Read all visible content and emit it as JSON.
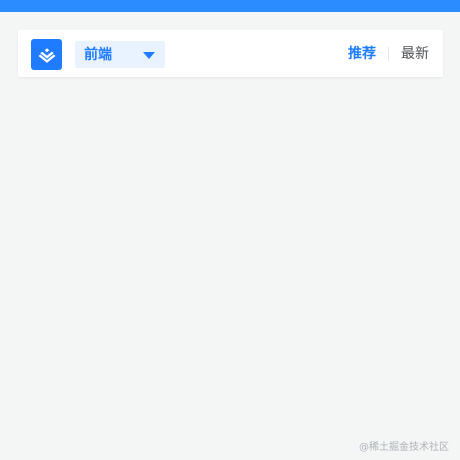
{
  "app": {
    "category_dropdown": {
      "selected": "前端"
    },
    "tabs": [
      {
        "label": "推荐"
      },
      {
        "label": "最新"
      }
    ],
    "watermark": "@稀土掘金技术社区"
  },
  "colors": {
    "brand_blue": "#1f7cff",
    "top_bar": "#2b8cff",
    "active_tab": "#1f7cff",
    "inactive_tab": "#4d4f53",
    "page_bg": "#f4f5f5",
    "card_bg": "#ffffff",
    "dropdown_bg": "#e8f3ff"
  },
  "icons": {
    "logo": "juejin-logo-icon",
    "dropdown": "caret-down-icon"
  }
}
